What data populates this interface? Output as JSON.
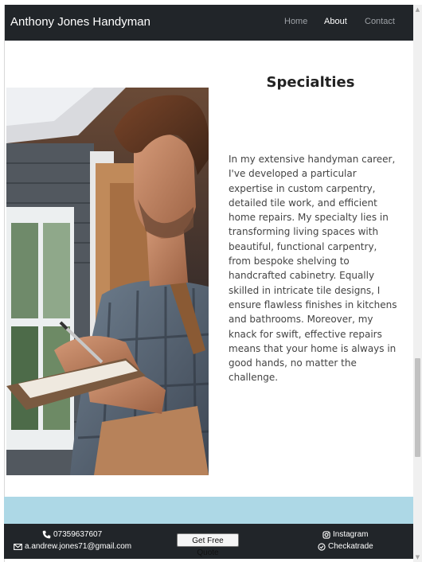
{
  "navbar": {
    "brand": "Anthony Jones Handyman",
    "links": [
      {
        "label": "Home",
        "active": false
      },
      {
        "label": "About",
        "active": true
      },
      {
        "label": "Contact",
        "active": false
      }
    ]
  },
  "section": {
    "heading": "Specialties",
    "paragraph": "In my extensive handyman career, I've developed a particular expertise in custom carpentry, detailed tile work, and efficient home repairs. My specialty lies in transforming living spaces with beautiful, functional carpentry, from bespoke shelving to handcrafted cabinetry. Equally skilled in intricate tile designs, I ensure flawless finishes in kitchens and bathrooms. Moreover, my knack for swift, effective repairs means that your home is always in good hands, no matter the challenge."
  },
  "footer": {
    "phone": "07359637607",
    "email": "a.andrew.jones71@gmail.com",
    "quote_button": "Get Free Quote",
    "instagram": "Instagram",
    "checkatrade": "Checkatrade"
  },
  "colors": {
    "navbar_bg": "#212529",
    "band": "#add8e6",
    "footer_bg": "#212529"
  },
  "icons": [
    "phone-icon",
    "envelope-icon",
    "instagram-icon",
    "check-circle-icon"
  ]
}
